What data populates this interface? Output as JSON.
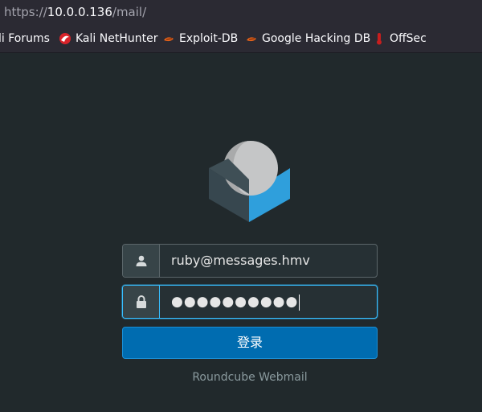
{
  "browser": {
    "url_scheme": "https://",
    "url_host": "10.0.0.136",
    "url_path": "/mail/",
    "bookmarks": [
      {
        "label": "li Forums",
        "icon": "kali-dragon-icon"
      },
      {
        "label": "Kali NetHunter",
        "icon": "nethunter-icon"
      },
      {
        "label": "Exploit-DB",
        "icon": "exploit-db-icon"
      },
      {
        "label": "Google Hacking DB",
        "icon": "ghdb-icon"
      },
      {
        "label": "OffSec",
        "icon": "offsec-icon"
      }
    ]
  },
  "login": {
    "logo_icon": "roundcube-logo-icon",
    "username": {
      "value": "ruby@messages.hmv",
      "icon": "user-icon"
    },
    "password": {
      "masked_value": "●●●●●●●●●●",
      "icon": "lock-icon"
    },
    "submit_label": "登录",
    "footer_link": "Roundcube Webmail"
  },
  "colors": {
    "background": "#21292c",
    "button": "#006cb0",
    "focus": "#37beff",
    "logo_blue": "#2f9fdc"
  }
}
